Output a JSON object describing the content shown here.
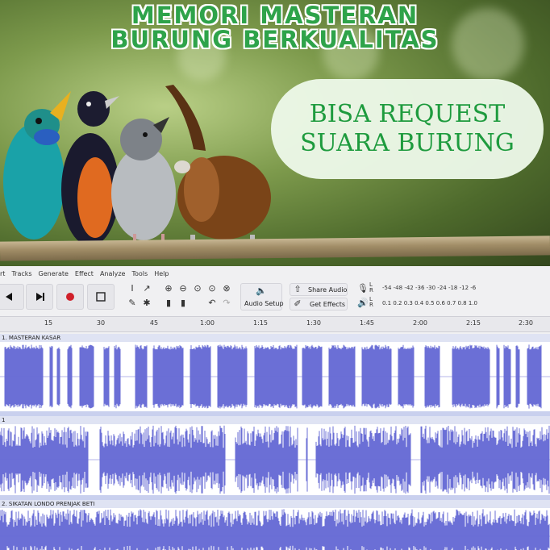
{
  "banner": {
    "title_line1": "MEMORI MASTERAN",
    "title_line2": "BURUNG BERKUALITAS",
    "pill_line1": "BISA REQUEST",
    "pill_line2": "SUARA BURUNG"
  },
  "menu": [
    "rt",
    "Tracks",
    "Generate",
    "Effect",
    "Analyze",
    "Tools",
    "Help"
  ],
  "toolbar": {
    "audio_setup": "Audio Setup",
    "share_audio": "Share Audio",
    "get_effects": "Get Effects",
    "record_meter": "-54 -48 -42 -36 -30 -24 -18 -12 -6",
    "play_meter": "0.1 0.2 0.3 0.4 0.5 0.6 0.7 0.8 1.0"
  },
  "ruler_ticks": [
    "15",
    "30",
    "45",
    "1:00",
    "1:15",
    "1:30",
    "1:45",
    "2:00",
    "2:15",
    "2:30"
  ],
  "tracks": [
    {
      "label": "1. MASTERAN KASAR"
    },
    {
      "label": "1"
    },
    {
      "label": "2. SIKATAN LONDO PRENJAK BETI"
    }
  ],
  "colors": {
    "waveform": "#6b6fd6",
    "title_green": "#2ea34a",
    "pill_text": "#1e9b3e"
  }
}
